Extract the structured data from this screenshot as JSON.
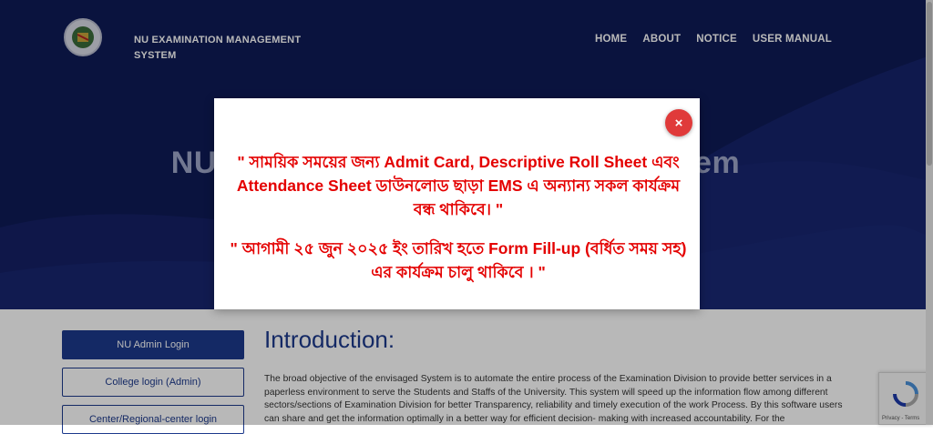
{
  "header": {
    "brand": "NU EXAMINATION MANAGEMENT SYSTEM",
    "nav": [
      "HOME",
      "ABOUT",
      "NOTICE",
      "USER MANUAL"
    ]
  },
  "hero": {
    "title": "NU Examination Management System"
  },
  "modal": {
    "close_label": "×",
    "notice1": "\" সাময়িক সময়ের জন্য Admit Card, Descriptive Roll Sheet এবং Attendance Sheet ডাউনলোড ছাড়া EMS এ অন্যান্য সকল কার্যক্রম বন্ধ থাকিবে। \"",
    "notice2": "\" আগামী ২৫ জুন ২০২৫ ইং তারিখ হতে Form Fill-up (বর্ধিত সময় সহ) এর কার্যক্রম চালু থাকিবে । \""
  },
  "sidebar": {
    "buttons": [
      "NU Admin Login",
      "College login (Admin)",
      "Center/Regional-center login"
    ]
  },
  "intro": {
    "title": "Introduction:",
    "text": "The broad objective of the envisaged System is to automate the entire process of the Examination Division to provide better services in a paperless environment to serve the Students and Staffs of the University. This system will speed up the information flow among different sectors/sections of Examination Division for better Transparency, reliability and timely execution of the work Process. By this software users can share and get the information optimally in a better way for efficient decision- making with increased accountability. For the"
  },
  "recaptcha": {
    "terms": "Privacy - Terms"
  },
  "colors": {
    "hero": "#0f1b57",
    "accent": "#1d3a8c",
    "notice": "#e40000",
    "close": "#e03a3a"
  }
}
